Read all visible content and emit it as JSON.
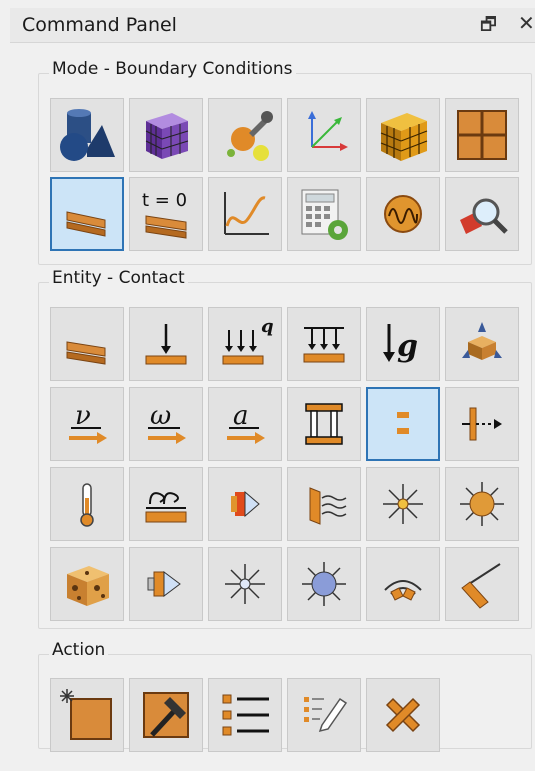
{
  "panel": {
    "title": "Command Panel",
    "float_glyph": "🗗",
    "close_glyph": "✕"
  },
  "groups": {
    "mode": {
      "label": "Mode - Boundary Conditions",
      "items": [
        {
          "name": "geometry-mode-icon",
          "tooltip": ""
        },
        {
          "name": "mesh-mode-icon",
          "tooltip": ""
        },
        {
          "name": "properties-mode-icon",
          "tooltip": ""
        },
        {
          "name": "coordinate-system-icon",
          "tooltip": ""
        },
        {
          "name": "element-block-icon",
          "tooltip": ""
        },
        {
          "name": "grid-icon",
          "tooltip": ""
        },
        {
          "name": "boundary-conditions-icon",
          "selected": true
        },
        {
          "name": "initial-conditions-icon",
          "text": "t = 0"
        },
        {
          "name": "function-curve-icon"
        },
        {
          "name": "calculator-settings-icon"
        },
        {
          "name": "waveform-icon"
        },
        {
          "name": "inspect-icon"
        }
      ]
    },
    "entity": {
      "label": "Entity - Contact",
      "italic_q": "q",
      "g_text": "g",
      "nu_text": "ν",
      "omega_text": "ω",
      "a_text": "a",
      "selected_index": 10
    },
    "action": {
      "label": "Action"
    }
  },
  "colors": {
    "orange": "#d98b3a",
    "orange_dark": "#a0561a",
    "selected_bg": "#cce4f7",
    "selected_border": "#2e74b5"
  }
}
